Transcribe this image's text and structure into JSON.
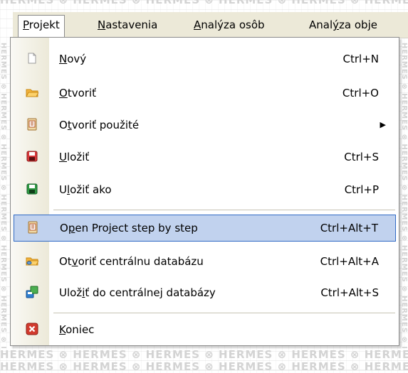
{
  "watermark": {
    "text": "HERMES ⊗ HERMES ⊗ HERMES ⊗ HERMES ⊗ HERMES ⊗ HERMES ⊗ HERMES"
  },
  "menubar": {
    "items": [
      {
        "pre": "",
        "ul": "P",
        "post": "rojekt",
        "active": true
      },
      {
        "pre": "",
        "ul": "N",
        "post": "astavenia"
      },
      {
        "pre": "",
        "ul": "A",
        "post": "nalýza osôb"
      },
      {
        "pre": "Anal",
        "ul": "ý",
        "post": "za obje"
      }
    ]
  },
  "menu": {
    "items": [
      {
        "pre": "",
        "ul": "N",
        "post": "ový",
        "shortcut": "Ctrl+N",
        "icon": "new-file-icon"
      },
      {
        "pre": "",
        "ul": "O",
        "post": "tvoriť",
        "shortcut": "Ctrl+O",
        "icon": "folder-open-icon"
      },
      {
        "pre": "O",
        "ul": "t",
        "post": "voriť použité",
        "shortcut": "",
        "icon": "recent-project-icon",
        "submenu": "▶"
      },
      {
        "pre": "",
        "ul": "U",
        "post": "ložiť",
        "shortcut": "Ctrl+S",
        "icon": "save-icon"
      },
      {
        "pre": "U",
        "ul": "l",
        "post": "ožiť ako",
        "shortcut": "Ctrl+P",
        "icon": "save-as-icon"
      },
      {
        "pre": "O",
        "ul": "p",
        "post": "en Project step by step",
        "shortcut": "Ctrl+Alt+T",
        "icon": "project-wizard-icon",
        "highlighted": true
      },
      {
        "pre": "Ot",
        "ul": "v",
        "post": "oriť centrálnu databázu",
        "shortcut": "Ctrl+Alt+A",
        "icon": "open-database-icon"
      },
      {
        "pre": "Ulož",
        "ul": "i",
        "post": "ť do centrálnej databázy",
        "shortcut": "Ctrl+Alt+S",
        "icon": "save-database-icon"
      },
      {
        "pre": "",
        "ul": "K",
        "post": "oniec",
        "shortcut": "",
        "icon": "exit-icon"
      }
    ]
  }
}
